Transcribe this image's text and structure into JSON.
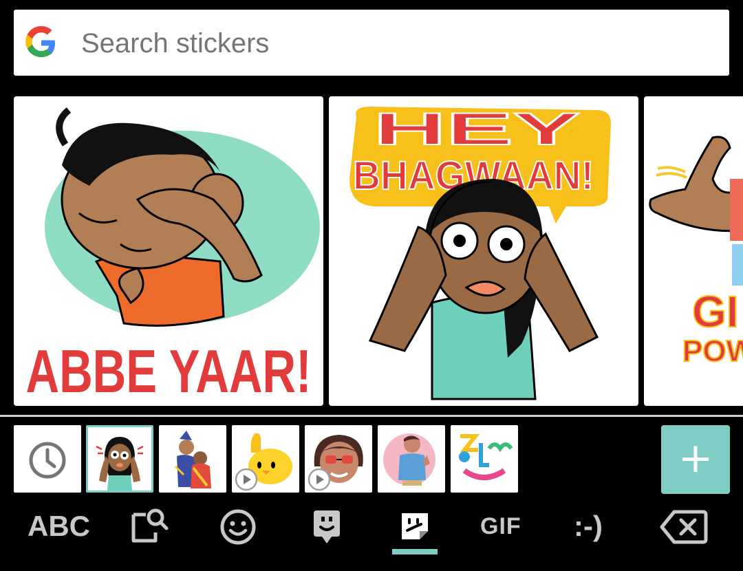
{
  "search": {
    "placeholder": "Search stickers"
  },
  "stickers": [
    {
      "caption": "ABBE YAAR!"
    },
    {
      "caption_line1": "HEY",
      "caption_line2": "BHAGWAAN!"
    },
    {
      "caption_line1": "GI",
      "caption_line2": "POW"
    }
  ],
  "packs": [
    {
      "icon": "recent-clock-icon"
    },
    {
      "icon": "hey-bhagwaan-pack",
      "selected": true
    },
    {
      "icon": "royal-couple-pack"
    },
    {
      "icon": "yellow-blob-pack",
      "animated": true
    },
    {
      "icon": "sunglasses-lady-pack",
      "animated": true
    },
    {
      "icon": "thumbs-up-man-pack"
    },
    {
      "icon": "colorful-face-pack"
    }
  ],
  "add_button": {
    "label": "+"
  },
  "bottom_bar": {
    "abc": "ABC",
    "gif": "GIF",
    "emoticon": ":-)"
  },
  "colors": {
    "accent": "#7fcdc4",
    "background": "#000000"
  }
}
